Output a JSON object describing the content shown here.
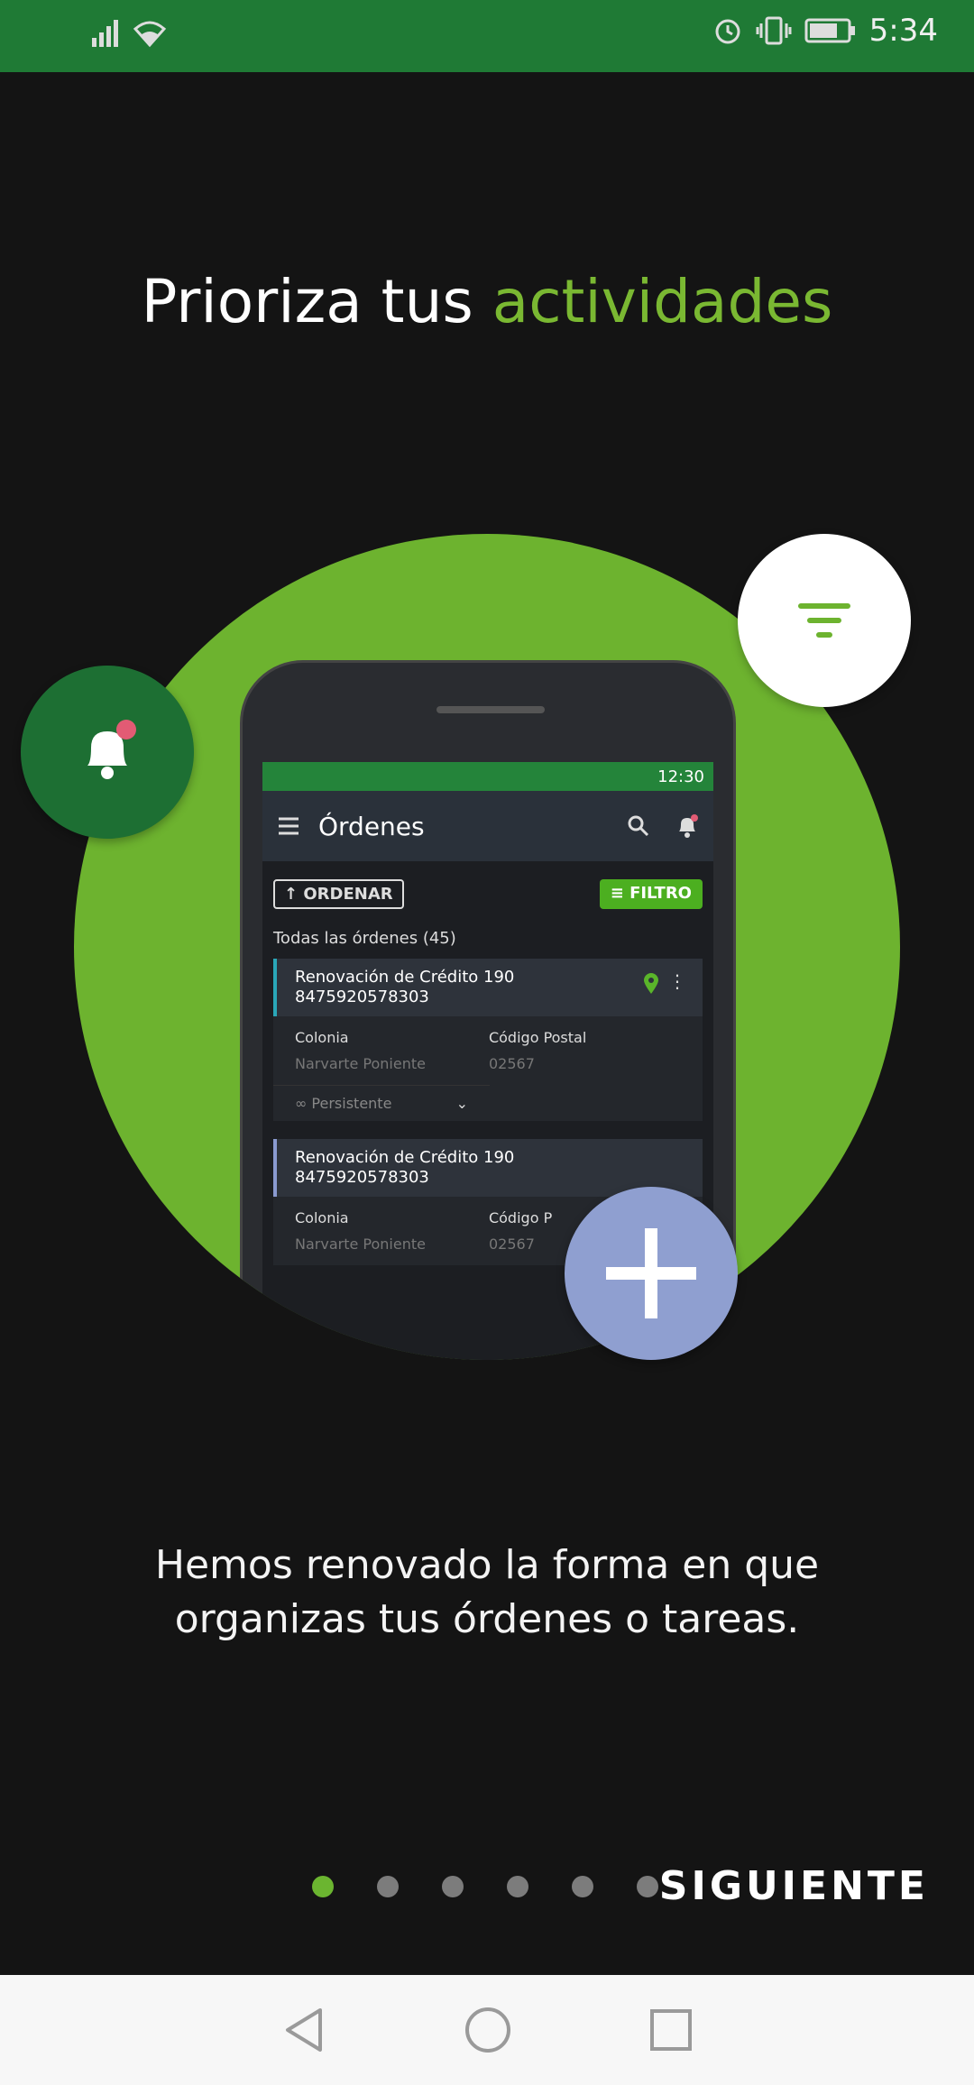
{
  "status_bar": {
    "time": "5:34"
  },
  "title": {
    "prefix": "Prioriza tus ",
    "accent": "actividades"
  },
  "phone_screen": {
    "status_time": "12:30",
    "app_title": "Órdenes",
    "sort_label": "ORDENAR",
    "filter_label": "FILTRO",
    "list_header": "Todas las órdenes (45)",
    "cards": [
      {
        "title": "Renovación de Crédito 190",
        "number": "8475920578303",
        "label1": "Colonia",
        "value1": "Narvarte Poniente",
        "label2": "Código Postal",
        "value2": "02567",
        "footer": "Persistente"
      },
      {
        "title": "Renovación de Crédito 190",
        "number": "8475920578303",
        "label1": "Colonia",
        "value1": "Narvarte Poniente",
        "label2": "Código P",
        "value2": "02567"
      }
    ]
  },
  "description": "Hemos renovado la forma en que organizas tus órdenes o tareas.",
  "pager": {
    "total": 6,
    "active": 0,
    "next_label": "SIGUIENTE"
  },
  "colors": {
    "accent": "#7ab832",
    "status_bar": "#1f7a35",
    "fab_bell": "#1d6f33",
    "fab_plus": "#8f9fd0"
  },
  "icons": [
    "signal-icon",
    "wifi-icon",
    "alarm-icon",
    "vibrate-icon",
    "battery-icon",
    "bell-icon",
    "filter-icon",
    "plus-icon",
    "back-icon",
    "home-icon",
    "recents-icon"
  ]
}
